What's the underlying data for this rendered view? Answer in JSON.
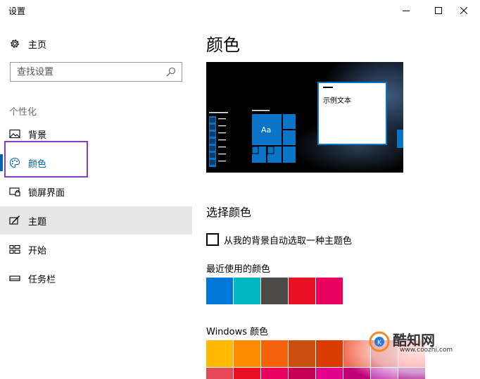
{
  "window": {
    "title": "设置",
    "minimize_icon": "minimize-icon",
    "maximize_icon": "maximize-icon",
    "close_icon": "close-icon"
  },
  "sidebar": {
    "home_label": "主页",
    "home_icon": "gear-icon",
    "search_placeholder": "查找设置",
    "search_icon": "search-icon",
    "section_label": "个性化",
    "items": [
      {
        "label": "背景",
        "icon": "picture-icon"
      },
      {
        "label": "颜色",
        "icon": "palette-icon",
        "state": "selected"
      },
      {
        "label": "锁屏界面",
        "icon": "lock-screen-icon"
      },
      {
        "label": "主题",
        "icon": "theme-brush-icon",
        "state": "hovered"
      },
      {
        "label": "开始",
        "icon": "start-menu-icon"
      },
      {
        "label": "任务栏",
        "icon": "taskbar-icon"
      }
    ],
    "accent_color": "#0063b1",
    "highlight_color": "#8a3cc1"
  },
  "main": {
    "title": "颜色",
    "preview": {
      "sample_text": "示例文本",
      "tile_label": "Aa",
      "accent_color": "#0a74c9"
    },
    "choose_color_title": "选择颜色",
    "auto_pick_label": "从我的背景自动选取一种主题色",
    "auto_pick_checked": false,
    "recent_colors_title": "最近使用的颜色",
    "recent_colors": [
      "#0078d7",
      "#00b7c3",
      "#4c4a48",
      "#e81123",
      "#ea005e"
    ],
    "windows_colors_title": "Windows 颜色",
    "windows_colors_row1": [
      "#ffb900",
      "#ff8c00",
      "#f7630c",
      "#ca5010",
      "#da3b01",
      "#ef6950",
      "#d13438",
      "#ff4343"
    ],
    "windows_colors_row2": [
      "#e74856",
      "#e81123",
      "#ea005e",
      "#c30052",
      "#e3008c",
      "#bf0077",
      "#c239b3",
      "#9a0089"
    ]
  },
  "watermark": {
    "brand": "酷知网",
    "url": "www.coozhi.com"
  }
}
